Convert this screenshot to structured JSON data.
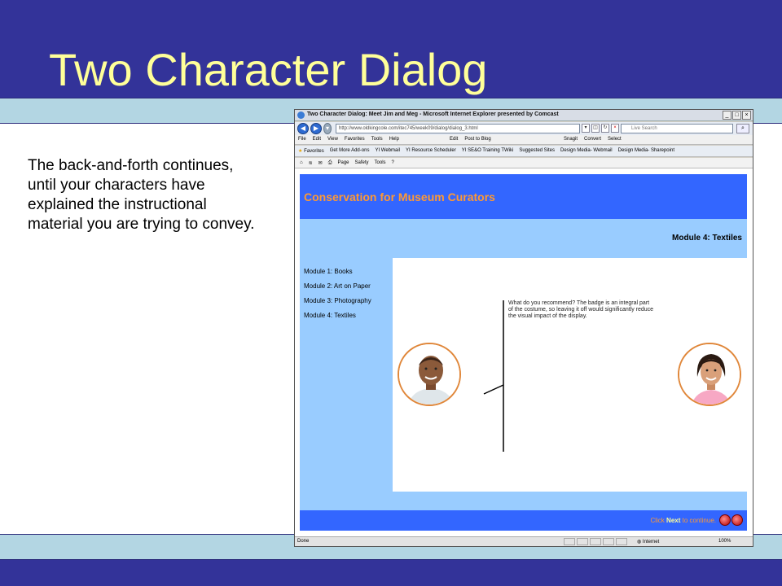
{
  "slide": {
    "title": "Two Character Dialog",
    "body": "The back-and-forth continues, until your characters have explained the instructional material you are trying to convey."
  },
  "browser": {
    "window_title": "Two Character Dialog: Meet Jim and Meg - Microsoft Internet Explorer presented by Comcast",
    "url": "http://www.oldkingcole.com/itec745/week09/dialog/dialog_3.html",
    "search_placeholder": "Live Search",
    "menu": [
      "File",
      "Edit",
      "View",
      "Favorites",
      "Tools",
      "Help"
    ],
    "toolbar_items": [
      "Edit",
      "Post to Blog"
    ],
    "toolbar_right": [
      "Snagit",
      "Convert",
      "Select"
    ],
    "favorites_label": "Favorites",
    "favorites": [
      "Get More Add-ons",
      "YI Webmail",
      "YI Resource Scheduler",
      "YI SE&O Training TWiki",
      "Suggested Sites",
      "Design Media- Webmail",
      "Design Media- Sharepoint"
    ],
    "command_items": [
      "Page",
      "Safety",
      "Tools"
    ],
    "status": "Done",
    "zone": "Internet",
    "zoom": "100%"
  },
  "page": {
    "header_title": "Conservation for Museum Curators",
    "module_title": "Module 4: Textiles",
    "nav": [
      "Module 1: Books",
      "Module 2: Art on Paper",
      "Module 3: Photography",
      "Module 4: Textiles"
    ],
    "speech": "What do you recommend? The badge is an integral part of the costume, so leaving it off would significantly reduce the visual impact of the display.",
    "footer_click": "Click",
    "footer_next": "Next",
    "footer_rest": "to continue."
  },
  "colors": {
    "slide_band": "#333399",
    "slide_title": "#ffff99",
    "page_header": "#3366ff",
    "page_bg": "#99ccff",
    "accent_orange": "#ff9933"
  }
}
